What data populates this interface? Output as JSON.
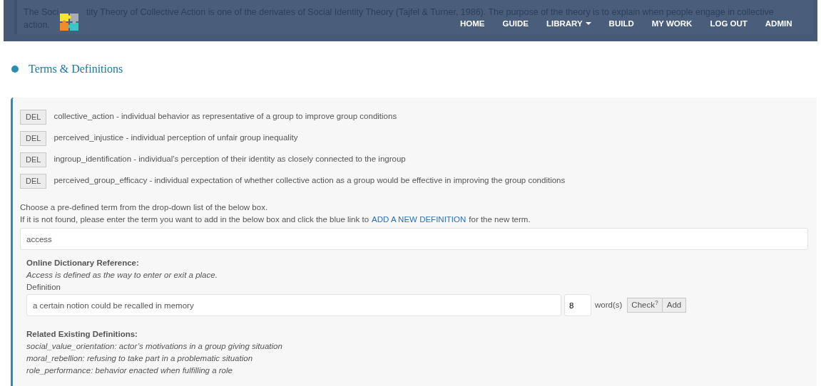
{
  "preview": {
    "pieces": [
      "The Soci",
      "tity Theory of Collective Action is one of the derivates of Social Identity Theory (Tajfel & Turner, 1986). The purpose of the theory is to explain when people engage in collective",
      "action."
    ]
  },
  "nav": {
    "items": [
      {
        "label": "HOME",
        "dropdown": false
      },
      {
        "label": "GUIDE",
        "dropdown": false
      },
      {
        "label": "LIBRARY",
        "dropdown": true
      },
      {
        "label": "BUILD",
        "dropdown": false
      },
      {
        "label": "MY WORK",
        "dropdown": false
      },
      {
        "label": "LOG OUT",
        "dropdown": false
      },
      {
        "label": "ADMIN",
        "dropdown": false
      }
    ]
  },
  "section": {
    "title": "Terms & Definitions"
  },
  "terms": [
    {
      "button": "DEL",
      "text": "collective_action - individual behavior as representative of a group to improve group conditions"
    },
    {
      "button": "DEL",
      "text": "perceived_injustice - individual perception of unfair group inequality"
    },
    {
      "button": "DEL",
      "text": "ingroup_identification - individual’s perception of their identity as closely connected to the ingroup"
    },
    {
      "button": "DEL",
      "text": "perceived_group_efficacy - individual expectation of whether collective action as a group would be effective in improving the group conditions"
    }
  ],
  "instructions": {
    "line1": "Choose a pre-defined term from the drop-down list of the below box.",
    "line2_before": "If it is not found, please enter the term you want to add in the below box and click the blue link to",
    "link": "ADD A NEW DEFINITION",
    "line2_after": "for the new term."
  },
  "term_field": {
    "value": "access"
  },
  "dictionary": {
    "heading": "Online Dictionary Reference:",
    "text": "Access is defined as the way to enter or exit a place."
  },
  "definition": {
    "label": "Definition",
    "value": "a certain notion could be recalled in memory",
    "count": "8",
    "count_label": "word(s)",
    "check_button": "Check$^{?}$",
    "add_button": "Add"
  },
  "related": {
    "heading": "Related Existing Definitions:",
    "items": [
      "social_value_orientation: actor’s motivations in a group giving situation",
      "moral_rebellion: refusing to take part in a problematic situation",
      "role_performance: behavior enacted when fulfilling a role"
    ]
  }
}
